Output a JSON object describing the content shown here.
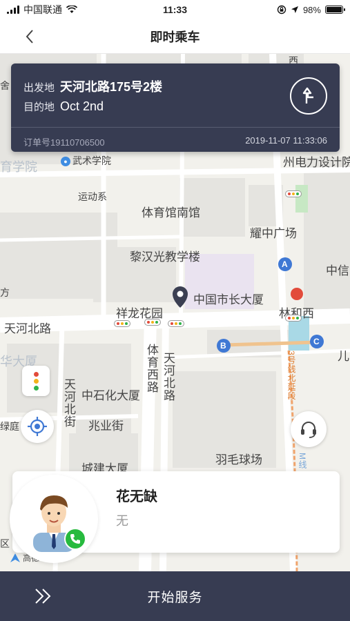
{
  "status_bar": {
    "carrier": "中国联通",
    "time": "11:33",
    "battery_text": "98%",
    "battery_level": 0.98
  },
  "header": {
    "title": "即时乘车"
  },
  "order": {
    "origin_label": "出发地",
    "origin_value": "天河北路175号2楼",
    "destination_label": "目的地",
    "destination_value": "Oct 2nd",
    "order_number": "订单号19110706500",
    "order_time": "2019-11-07 11:33:06"
  },
  "map": {
    "labels": {
      "edu_college": "育学院",
      "wushu": "武术学院",
      "yundong": "运动系",
      "tiyuguan": "体育馆南馆",
      "lihanguang": "黎汉光教学楼",
      "yaozhong": "耀中广场",
      "zhongxin": "中信",
      "shizhang": "中国市长大厦",
      "xianglong": "祥龙花园",
      "linhexi": "林和西",
      "tianhebeilu_h": "天河北路",
      "huada": "华大厦",
      "zhongshihua": "中石化大厦",
      "zhaoyejie": "兆业街",
      "chengjian": "城建大厦",
      "yumao": "羽毛球场",
      "lvting": "绿庭",
      "tiyu_xilu": "体育西路",
      "tianhe_beilu_v": "天河北路",
      "tianhe_beijie": "天河北街",
      "dianli": "州电力设计院",
      "line3": "3号线北延段",
      "line_m": "M线",
      "er": "儿",
      "xin": "信",
      "qu": "区",
      "she": "舍",
      "fang": "方",
      "xi": "西"
    },
    "logo_text": "高德地图",
    "accent": "#3f8de2",
    "road_color": "#ffffff",
    "block_color": "#e5e4e0"
  },
  "driver": {
    "name": "花无缺",
    "subtitle": "无"
  },
  "action": {
    "start_label": "开始服务"
  },
  "colors": {
    "panel": "#373c52",
    "phone_green": "#27ba3e"
  }
}
